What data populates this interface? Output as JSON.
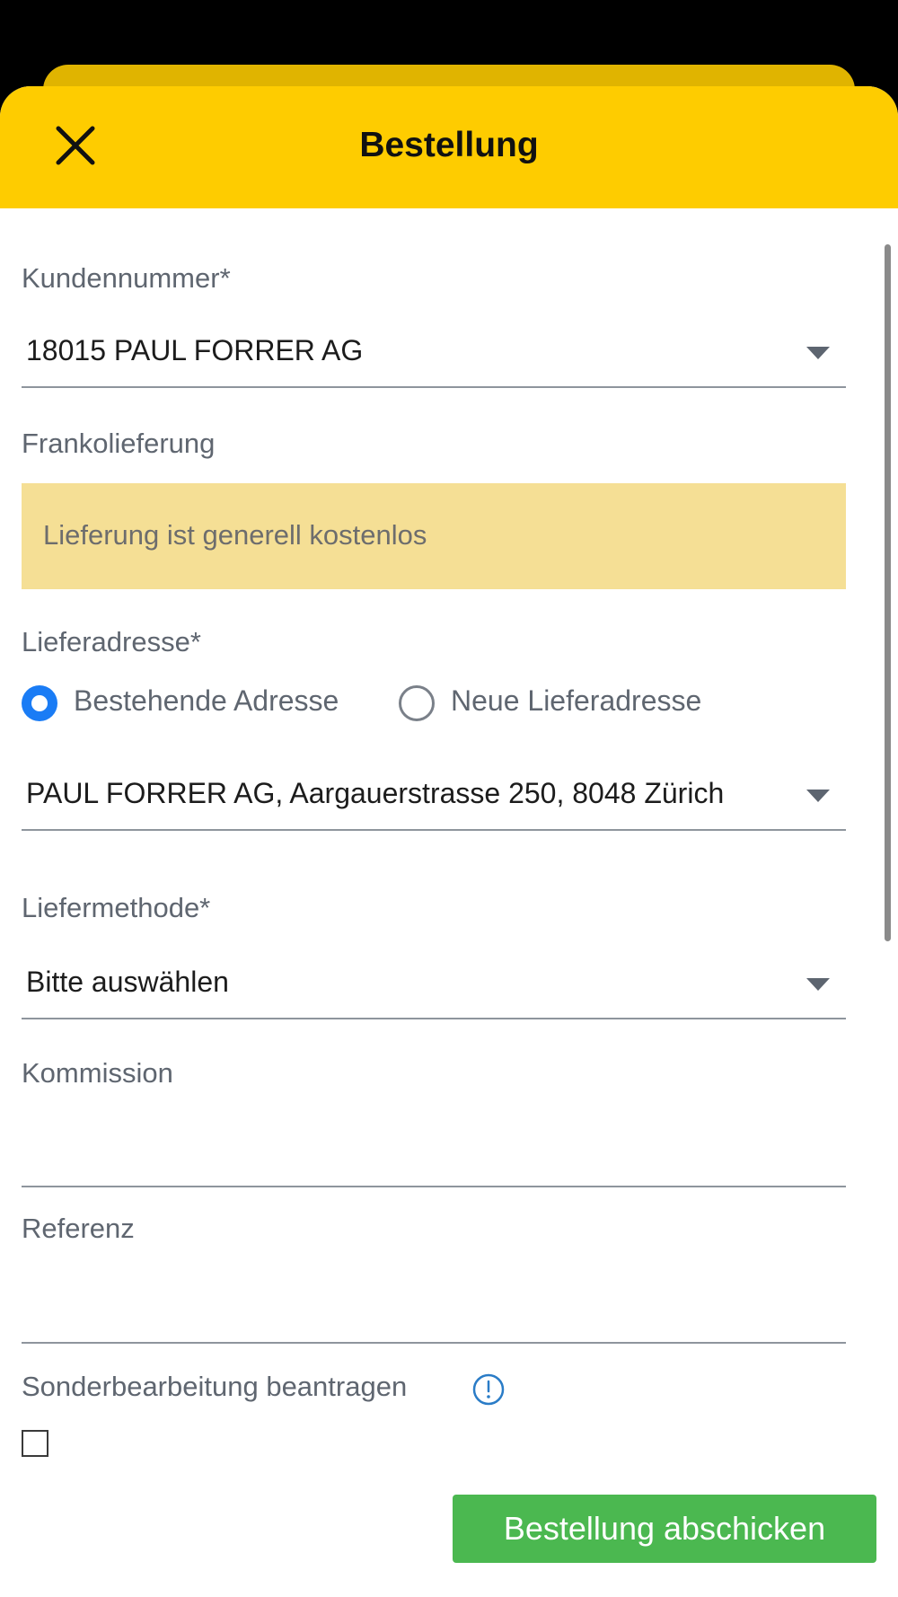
{
  "header": {
    "title": "Bestellung",
    "close_icon": "close-icon"
  },
  "form": {
    "customer_number": {
      "label": "Kundennummer*",
      "value": "18015 PAUL FORRER AG"
    },
    "free_delivery": {
      "label": "Frankolieferung",
      "notice": "Lieferung ist generell kostenlos"
    },
    "delivery_address": {
      "label": "Lieferadresse*",
      "options": [
        {
          "label": "Bestehende Adresse",
          "selected": true
        },
        {
          "label": "Neue Lieferadresse",
          "selected": false
        }
      ],
      "value": "PAUL FORRER AG, Aargauerstrasse 250, 8048 Zürich"
    },
    "delivery_method": {
      "label": "Liefermethode*",
      "value": "Bitte auswählen"
    },
    "commission": {
      "label": "Kommission",
      "value": ""
    },
    "reference": {
      "label": "Referenz",
      "value": ""
    },
    "special_processing": {
      "label": "Sonderbearbeitung beantragen",
      "info_icon": "info-icon",
      "checked": false
    },
    "submit_label": "Bestellung abschicken"
  },
  "colors": {
    "header_yellow": "#fecc00",
    "notice_yellow": "#f5df95",
    "radio_blue": "#1a7cf5",
    "submit_green": "#4bb850"
  }
}
